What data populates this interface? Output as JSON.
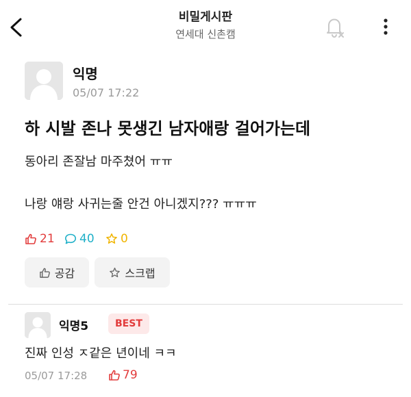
{
  "header": {
    "title": "비밀게시판",
    "subtitle": "연세대 신촌캠"
  },
  "post": {
    "author": "익명",
    "date": "05/07 17:22",
    "title": "하 시발 존나 못생긴 남자애랑 걸어가는데",
    "body_lines": [
      "동아리 존잘남 마주쳤어 ㅠㅠ",
      "나랑 얘랑 사귀는줄 안건 아니겠지??? ㅠㅠㅠ"
    ],
    "stats": {
      "likes": "21",
      "comments": "40",
      "scraps": "0"
    },
    "actions": {
      "like_label": "공감",
      "scrap_label": "스크랩"
    }
  },
  "comment": {
    "author": "익명5",
    "badge": "BEST",
    "text": "진짜 인성 ㅈ같은 년이네 ㅋㅋ",
    "date": "05/07 17:28",
    "likes": "79"
  },
  "icons": {
    "back": "chevron-left-icon",
    "notifications": "bell-off-icon",
    "more": "more-vertical-icon",
    "like": "thumbs-up-icon",
    "comment": "speech-bubble-icon",
    "scrap": "star-icon"
  },
  "colors": {
    "like": "#e23b3b",
    "comment": "#1fb0c8",
    "scrap": "#f0b400",
    "badge_bg": "#fde9e9"
  }
}
